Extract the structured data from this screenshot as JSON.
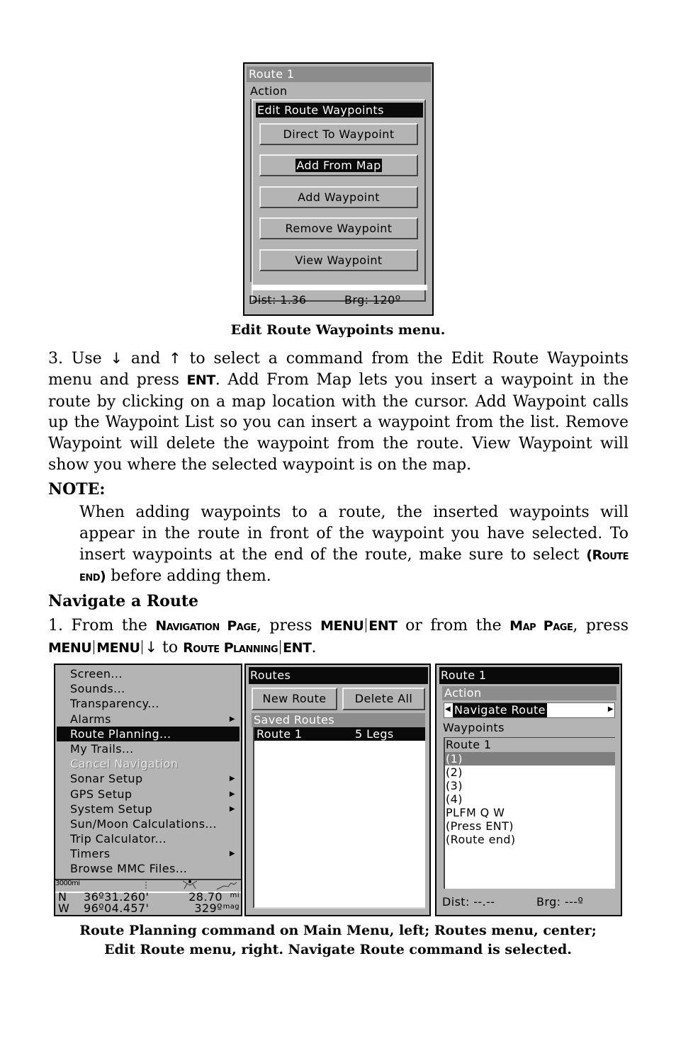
{
  "top_screen": {
    "title": "Route 1",
    "action_label": "Action",
    "popup_title": "Edit Route Waypoints",
    "buttons": [
      {
        "label": "Direct To Waypoint",
        "selected": false
      },
      {
        "label": "Add From Map",
        "selected": true
      },
      {
        "label": "Add Waypoint",
        "selected": false
      },
      {
        "label": "Remove Waypoint",
        "selected": false
      },
      {
        "label": "View Waypoint",
        "selected": false
      }
    ],
    "dist": "Dist: 1.36",
    "brg": "Brg: 120º"
  },
  "caption_top": "Edit Route Waypoints menu.",
  "step3": {
    "p1": "3. Use ",
    "down_arrow": "↓",
    "p2": " and ",
    "up_arrow": "↑",
    "p3": " to select a command from the Edit Route Waypoints menu and press ",
    "ent": "ENT",
    "p4": ". Add From Map lets you insert a waypoint in the route by clicking on a map location with the cursor. Add Waypoint calls up the Waypoint List so you can insert a waypoint from the list. Remove Waypoint will delete the waypoint from the route. View Waypoint will show you where the selected waypoint is on the map."
  },
  "note": {
    "heading": "NOTE:",
    "p1": "When adding waypoints to a route, the inserted waypoints will appear in the route in front of the waypoint you have selected. To insert waypoints at the end of the route, make sure to select ",
    "route_end": "(Route end)",
    "p2": " before adding them."
  },
  "section_heading": "Navigate a Route",
  "step1": {
    "p1": "1. From the ",
    "nav_page": "Navigation Page",
    "p2": ", press ",
    "menu": "MENU",
    "ent": "ENT",
    "p3": " or from the ",
    "map_page": "Map Page",
    "p4": ", press ",
    "down_arrow": "↓",
    "p5": " to ",
    "route_planning": "Route Planning",
    "p6": "."
  },
  "left_screen": {
    "menu_items": [
      {
        "label": "Screen...",
        "submenu": false,
        "selected": false,
        "disabled": false
      },
      {
        "label": "Sounds...",
        "submenu": false,
        "selected": false,
        "disabled": false
      },
      {
        "label": "Transparency...",
        "submenu": false,
        "selected": false,
        "disabled": false
      },
      {
        "label": "Alarms",
        "submenu": true,
        "selected": false,
        "disabled": false
      },
      {
        "label": "Route Planning...",
        "submenu": false,
        "selected": true,
        "disabled": false
      },
      {
        "label": "My Trails...",
        "submenu": false,
        "selected": false,
        "disabled": false
      },
      {
        "label": "Cancel Navigation",
        "submenu": false,
        "selected": false,
        "disabled": true
      },
      {
        "label": "Sonar Setup",
        "submenu": true,
        "selected": false,
        "disabled": false
      },
      {
        "label": "GPS Setup",
        "submenu": true,
        "selected": false,
        "disabled": false
      },
      {
        "label": "System Setup",
        "submenu": true,
        "selected": false,
        "disabled": false
      },
      {
        "label": "Sun/Moon Calculations...",
        "submenu": false,
        "selected": false,
        "disabled": false
      },
      {
        "label": "Trip Calculator...",
        "submenu": false,
        "selected": false,
        "disabled": false
      },
      {
        "label": "Timers",
        "submenu": true,
        "selected": false,
        "disabled": false
      },
      {
        "label": "Browse MMC Files...",
        "submenu": false,
        "selected": false,
        "disabled": false
      }
    ],
    "submenu_glyph": "▶",
    "map_scale": "3000mi",
    "lat_hemi": "N",
    "lat": "36º31.260'",
    "lon_hemi": "W",
    "lon": "96º04.457'",
    "distance": "28.70",
    "distance_unit": "mi",
    "heading": "329º",
    "heading_unit": "mag"
  },
  "center_screen": {
    "title": "Routes",
    "new_route_label": "New Route",
    "delete_all_label": "Delete All",
    "saved_routes_label": "Saved Routes",
    "routes": [
      {
        "name": "Route 1",
        "legs": "5 Legs",
        "selected": true
      }
    ]
  },
  "right_screen": {
    "title": "Route 1",
    "action_label": "Action",
    "action_value": "Navigate Route",
    "left_arrow": "◀",
    "right_arrow": "▶",
    "waypoints_label": "Waypoints",
    "list_header": "Route 1",
    "waypoints": [
      {
        "label": "(1)",
        "selected": true
      },
      {
        "label": "(2)",
        "selected": false
      },
      {
        "label": "(3)",
        "selected": false
      },
      {
        "label": "(4)",
        "selected": false
      },
      {
        "label": "PLFM Q W",
        "selected": false
      },
      {
        "label": "(Press ENT)",
        "selected": false
      },
      {
        "label": "(Route end)",
        "selected": false
      }
    ],
    "dist": "Dist: --.--",
    "brg": "Brg: ---º"
  },
  "caption_bottom_line1": "Route Planning command on Main Menu, left; Routes  menu, center;",
  "caption_bottom_line2": "Edit Route menu, right. Navigate Route command is selected."
}
